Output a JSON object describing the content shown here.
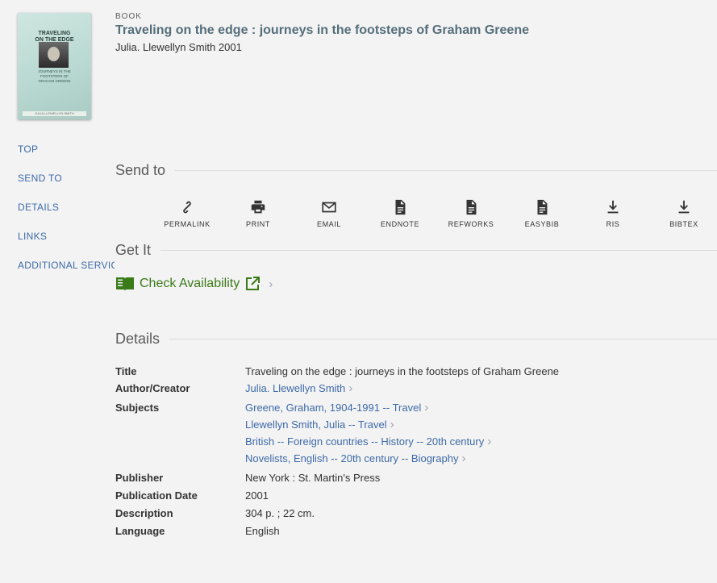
{
  "record": {
    "type_label": "BOOK",
    "title": "Traveling on the edge : journeys in the footsteps of Graham Greene",
    "author_line": "Julia. Llewellyn Smith 2001"
  },
  "cover": {
    "title_line1": "TRAVELING",
    "title_line2": "ON THE EDGE",
    "subtitle_line1": "JOURNEYS IN THE",
    "subtitle_line2": "FOOTSTEPS OF",
    "subtitle_line3": "GRAHAM GREENE",
    "footer": "JULIA LLEWELLYN SMITH"
  },
  "nav": {
    "top": "TOP",
    "send_to": "SEND TO",
    "details": "DETAILS",
    "links": "LINKS",
    "additional": "ADDITIONAL SERVICES"
  },
  "sections": {
    "send_to": "Send to",
    "get_it": "Get It",
    "details": "Details"
  },
  "actions": {
    "permalink": "PERMALINK",
    "print": "PRINT",
    "email": "EMAIL",
    "endnote": "ENDNOTE",
    "refworks": "REFWORKS",
    "easybib": "EASYBIB",
    "ris": "RIS",
    "bibtex": "BIBTEX"
  },
  "get_it": {
    "label": "Check Availability",
    "icon": "open-book-icon",
    "accent": "#3a7a19"
  },
  "details": {
    "title_label": "Title",
    "title_value": "Traveling on the edge : journeys in the footsteps of Graham Greene",
    "author_label": "Author/Creator",
    "author_value": "Julia. Llewellyn Smith",
    "subjects_label": "Subjects",
    "subjects": [
      "Greene, Graham, 1904-1991 -- Travel",
      "Llewellyn Smith, Julia -- Travel",
      "British -- Foreign countries -- History -- 20th century",
      "Novelists, English -- 20th century -- Biography"
    ],
    "publisher_label": "Publisher",
    "publisher_value": "New York : St. Martin's Press",
    "date_label": "Publication Date",
    "date_value": "2001",
    "description_label": "Description",
    "description_value": "304 p. ; 22 cm.",
    "language_label": "Language",
    "language_value": "English"
  },
  "colors": {
    "link": "#3d6aa8",
    "title": "#546e7a",
    "background": "#f3f3f3"
  }
}
